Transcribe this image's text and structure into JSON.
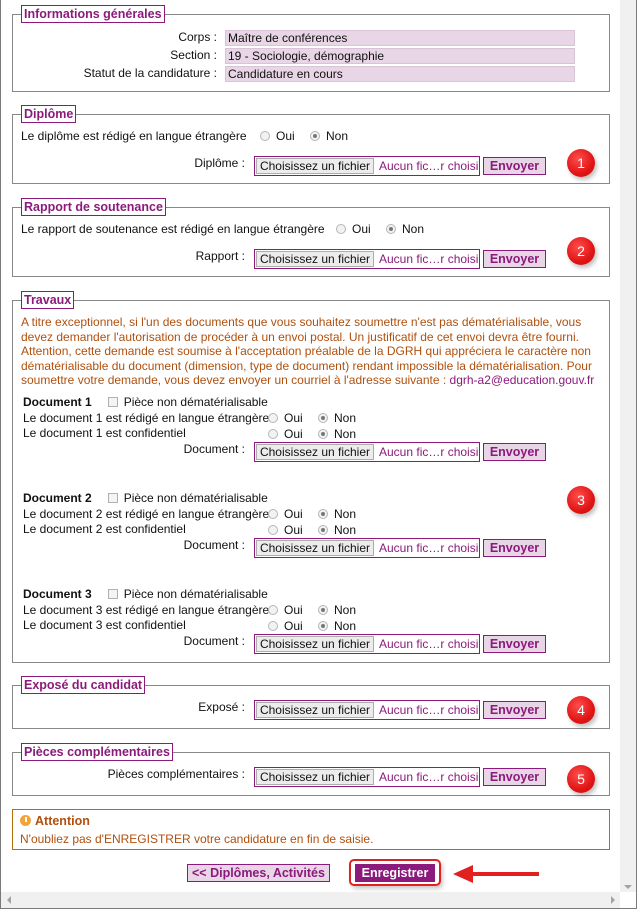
{
  "general": {
    "legend": "Informations générales",
    "rows": [
      {
        "label": "Corps :",
        "value": "Maître de conférences"
      },
      {
        "label": "Section :",
        "value": "19 - Sociologie, démographie"
      },
      {
        "label": "Statut de la candidature :",
        "value": "Candidature en cours"
      }
    ]
  },
  "common": {
    "choose_file": "Choisissez un fichier",
    "no_file": "Aucun fic…r choisi",
    "send": "Envoyer",
    "yes": "Oui",
    "no": "Non"
  },
  "diplome": {
    "legend": "Diplôme",
    "question": "Le diplôme est rédigé en langue étrangère",
    "selected": "Non",
    "file_label": "Diplôme :",
    "badge": "1"
  },
  "rapport": {
    "legend": "Rapport de soutenance",
    "question": "Le rapport de soutenance est rédigé en langue étrangère",
    "selected": "Non",
    "file_label": "Rapport :",
    "badge": "2"
  },
  "travaux": {
    "legend": "Travaux",
    "note": "A titre exceptionnel, si l'un des documents que vous souhaitez soumettre n'est pas dématérialisable, vous devez demander l'autorisation de procéder à un envoi postal. Un justificatif de cet envoi devra être fourni. Attention, cette demande est soumise à l'acceptation préalable de la DGRH qui appréciera le caractère non dématérialisable du document (dimension, type de document) rendant impossible la dématérialisation. Pour soumettre votre demande, vous devez envoyer un courriel à l'adresse suivante : ",
    "email": "dgrh-a2@education.gouv.fr",
    "badge": "3",
    "documents": [
      {
        "title": "Document 1",
        "non_dematerialisable": "Pièce non dématérialisable",
        "checked": false,
        "lang_question": "Le document 1 est rédigé en langue étrangère",
        "lang_selected": "Non",
        "conf_question": "Le document 1 est confidentiel",
        "conf_selected": "Non",
        "file_label": "Document :"
      },
      {
        "title": "Document 2",
        "non_dematerialisable": "Pièce non dématérialisable",
        "checked": false,
        "lang_question": "Le document 2 est rédigé en langue étrangère",
        "lang_selected": "Non",
        "conf_question": "Le document 2 est confidentiel",
        "conf_selected": "Non",
        "file_label": "Document :"
      },
      {
        "title": "Document 3",
        "non_dematerialisable": "Pièce non dématérialisable",
        "checked": false,
        "lang_question": "Le document 3 est rédigé en langue étrangère",
        "lang_selected": "Non",
        "conf_question": "Le document 3 est confidentiel",
        "conf_selected": "Non",
        "file_label": "Document :"
      }
    ]
  },
  "expose": {
    "legend": "Exposé du candidat",
    "file_label": "Exposé :",
    "badge": "4"
  },
  "pieces": {
    "legend": "Pièces complémentaires",
    "file_label": "Pièces complémentaires :",
    "badge": "5"
  },
  "attention": {
    "title": "Attention",
    "message": "N'oubliez pas d'ENREGISTRER votre candidature en fin de saisie."
  },
  "footer": {
    "prev_label": "<< Diplômes, Activités",
    "save_label": "Enregistrer"
  },
  "colors": {
    "brand": "#8b1a7c",
    "field_bg": "#e8d5e5",
    "note_text": "#b0500e",
    "badge_red": "#e01515"
  }
}
